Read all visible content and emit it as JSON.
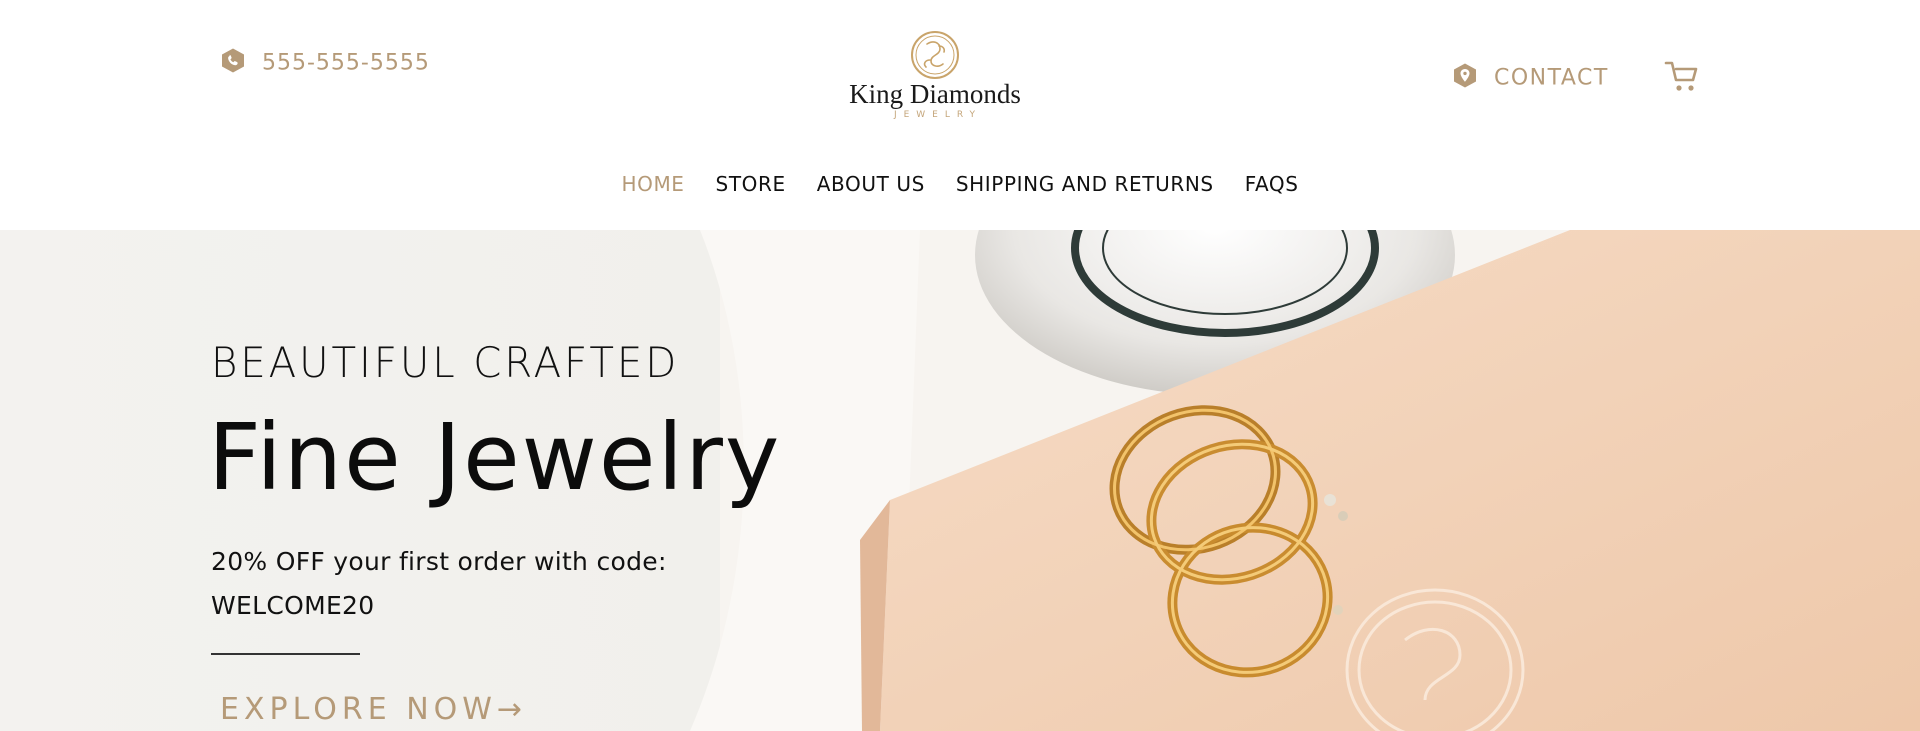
{
  "header": {
    "phone": "555-555-5555",
    "contact": "CONTACT",
    "logo": {
      "name": "King Diamonds",
      "sub": "JEWELRY"
    }
  },
  "nav": {
    "items": [
      {
        "label": "HOME",
        "active": true
      },
      {
        "label": "STORE"
      },
      {
        "label": "ABOUT US"
      },
      {
        "label": "SHIPPING AND RETURNS"
      },
      {
        "label": "FAQS"
      }
    ]
  },
  "hero": {
    "kicker": "BEAUTIFUL CRAFTED",
    "title": "Fine Jewelry",
    "offer_line1": "20% OFF your first order with code:",
    "offer_line2": "WELCOME20",
    "cta": "EXPLORE NOW→"
  },
  "colors": {
    "accent": "#b59a78",
    "text": "#111111",
    "box": "#f1d3bc"
  },
  "icons": {
    "phone": "phone-icon",
    "contact": "location-pin-icon",
    "cart": "cart-icon"
  }
}
